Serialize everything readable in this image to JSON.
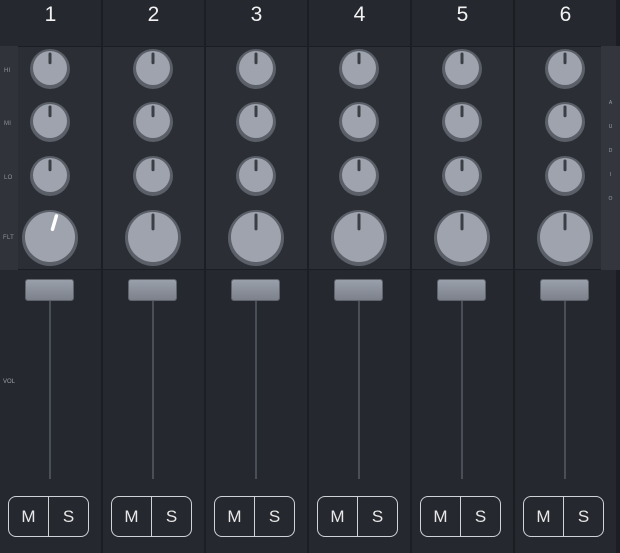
{
  "mixer": {
    "row_labels": [
      "HI",
      "MI",
      "LO",
      "FLT"
    ],
    "vol_label": "VOL",
    "side_label": [
      "A",
      "U",
      "D",
      "I",
      "O"
    ],
    "channels": [
      {
        "number": "1",
        "mute": "M",
        "solo": "S",
        "knobs": [
          0,
          0,
          0,
          0.12
        ],
        "active_filter": true
      },
      {
        "number": "2",
        "mute": "M",
        "solo": "S",
        "knobs": [
          0,
          0,
          0,
          0
        ],
        "active_filter": false
      },
      {
        "number": "3",
        "mute": "M",
        "solo": "S",
        "knobs": [
          0,
          0,
          0,
          0
        ],
        "active_filter": false
      },
      {
        "number": "4",
        "mute": "M",
        "solo": "S",
        "knobs": [
          0,
          0,
          0,
          0
        ],
        "active_filter": false
      },
      {
        "number": "5",
        "mute": "M",
        "solo": "S",
        "knobs": [
          0,
          0,
          0,
          0
        ],
        "active_filter": false
      },
      {
        "number": "6",
        "mute": "M",
        "solo": "S",
        "knobs": [
          0,
          0,
          0,
          0
        ],
        "active_filter": false
      }
    ],
    "fader_level": 1.0
  },
  "colors": {
    "background": "#1b1e22",
    "channel": "#25282e",
    "panel": "#2b2f35",
    "knob_body": "#9ea3ad",
    "knob_ring": "#5a5f68",
    "indicator": "#3a3e45",
    "indicator_active": "#ffffff",
    "text": "#f2f2f2"
  }
}
